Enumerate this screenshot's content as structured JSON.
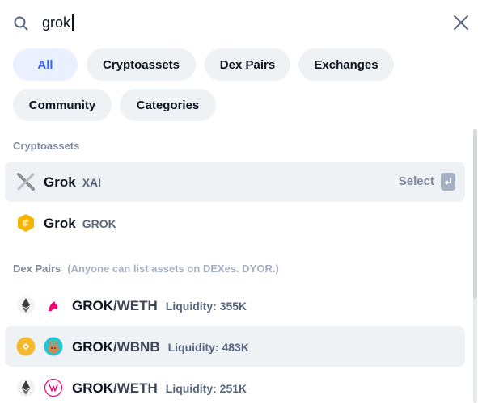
{
  "search": {
    "value": "grok"
  },
  "filters": [
    {
      "label": "All",
      "active": true
    },
    {
      "label": "Cryptoassets",
      "active": false
    },
    {
      "label": "Dex Pairs",
      "active": false
    },
    {
      "label": "Exchanges",
      "active": false
    },
    {
      "label": "Community",
      "active": false
    },
    {
      "label": "Categories",
      "active": false
    }
  ],
  "cryptoassets": {
    "heading": "Cryptoassets",
    "items": [
      {
        "name": "Grok",
        "symbol": "XAI",
        "icon": "x-logo-icon",
        "highlighted": true,
        "action": "Select"
      },
      {
        "name": "Grok",
        "symbol": "GROK",
        "icon": "grok-logo-icon",
        "highlighted": false
      }
    ]
  },
  "dex_pairs": {
    "heading": "Dex Pairs",
    "note": "(Anyone can list assets on DEXes. DYOR.)",
    "items": [
      {
        "base": "GROK",
        "quote": "/WETH",
        "liquidity": "Liquidity: 355K",
        "chain_icon": "ethereum-icon",
        "dex_icon": "uniswap-icon",
        "highlighted": false
      },
      {
        "base": "GROK",
        "quote": "/WBNB",
        "liquidity": "Liquidity: 483K",
        "chain_icon": "bnb-chain-icon",
        "dex_icon": "pancakeswap-icon",
        "highlighted": true
      },
      {
        "base": "GROK",
        "quote": "/WETH",
        "liquidity": "Liquidity: 251K",
        "chain_icon": "ethereum-icon",
        "dex_icon": "uniswap-v3-icon",
        "highlighted": false
      }
    ]
  },
  "colors": {
    "accent": "#3861fb",
    "chip_bg": "#eff2f5",
    "active_chip_bg": "#eaf0ff",
    "muted": "#808a9d"
  }
}
